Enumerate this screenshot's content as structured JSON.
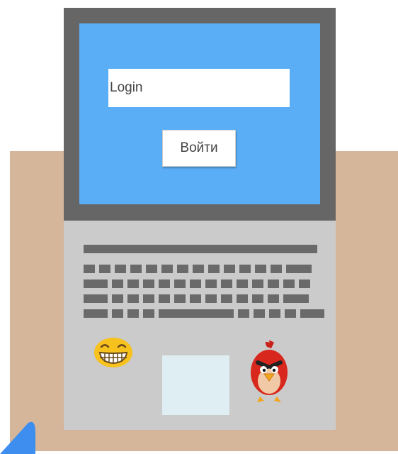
{
  "login": {
    "placeholder": "Login",
    "button_label": "Войти"
  },
  "colors": {
    "screen": "#5aaef6",
    "bezel": "#666666",
    "base": "#cbcbcb",
    "desk": "#d6b69a",
    "trackpad": "#dfeef3"
  },
  "icons": [
    "grinning-emoji-icon",
    "angry-bird-icon"
  ]
}
